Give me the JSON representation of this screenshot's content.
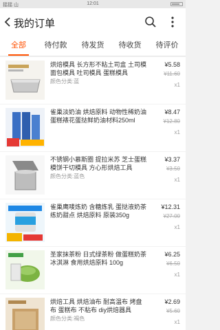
{
  "status_bar": {
    "carrier": "揺揺 山",
    "time": "12:01"
  },
  "header": {
    "title": "我的订单",
    "back_icon": "chevron-left-icon",
    "search_icon": "search-icon",
    "more_icon": "more-vertical-icon"
  },
  "tabs": [
    {
      "label": "全部",
      "active": true
    },
    {
      "label": "待付款",
      "active": false
    },
    {
      "label": "待发货",
      "active": false
    },
    {
      "label": "待收货",
      "active": false
    },
    {
      "label": "待评价",
      "active": false
    }
  ],
  "orders": [
    {
      "title": "烘焙模具 长方形不粘土司盒 土司模 面包模具 吐司模具 蛋糕模具",
      "spec": "颜色分类:蓝",
      "price": "¥5.58",
      "orig_price": "¥11.60",
      "qty": "x1"
    },
    {
      "title": "雀巢淡奶油 烘焙原料 动物性稀奶油蛋糕裱花蛋挞鲜奶油材料250ml",
      "spec": "",
      "price": "¥8.47",
      "orig_price": "¥12.80",
      "qty": "x1"
    },
    {
      "title": "不锈钢小慕斯圈 提拉米苏 芝士蛋糕模饼干切模具 方心形烘焙工具",
      "spec": "颜色分类:蓝色",
      "price": "¥3.37",
      "orig_price": "¥3.50",
      "qty": "x1"
    },
    {
      "title": "雀巢鹰唛炼奶 含糖炼乳 蛋挞液奶茶练奶甜点 烘焙原料 原装350g",
      "spec": "",
      "price": "¥12.31",
      "orig_price": "¥27.00",
      "qty": "x1"
    },
    {
      "title": "圣家抹茶粉 日式绿茶粉 做蛋糕奶茶冰淇淋 食用烘焙原料 100g",
      "spec": "",
      "price": "¥6.25",
      "orig_price": "¥6.50",
      "qty": "x1"
    },
    {
      "title": "烘焙工具 烘焙油布 耐高温布 烤盘布 蛋糕布 不粘布 diy烘焙器具",
      "spec": "颜色分类:褐色",
      "price": "¥2.69",
      "orig_price": "¥5.60",
      "qty": "x1"
    }
  ],
  "colors": {
    "accent": "#ff5000"
  }
}
